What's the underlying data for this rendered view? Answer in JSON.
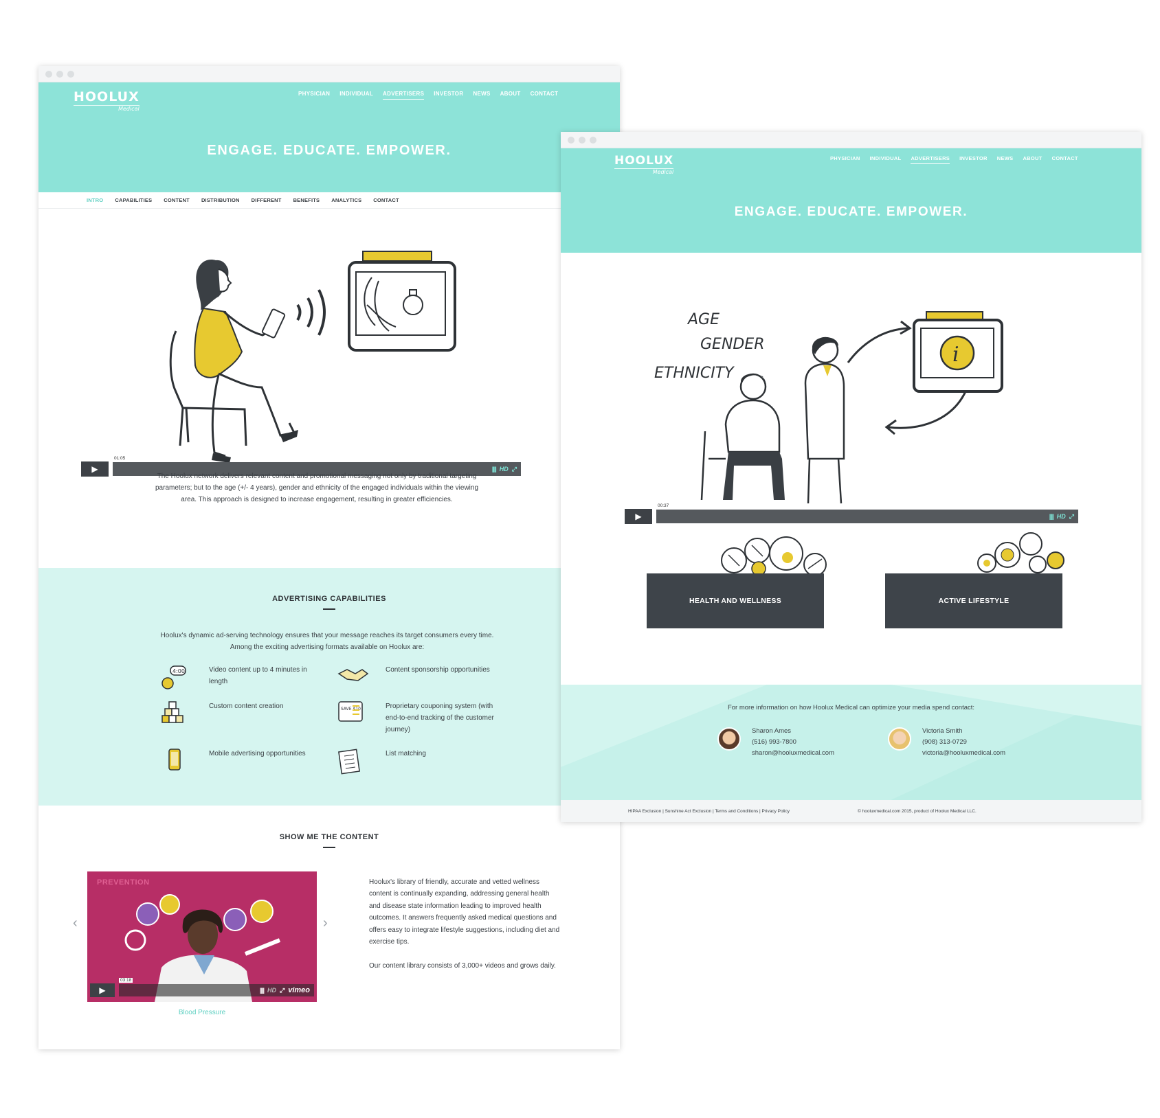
{
  "window_a": {
    "logo": "HOOLUX",
    "logo_sub": "Medical",
    "nav": [
      "PHYSICIAN",
      "INDIVIDUAL",
      "ADVERTISERS",
      "INVESTOR",
      "NEWS",
      "ABOUT",
      "CONTACT"
    ],
    "hero_title": "ENGAGE. EDUCATE. EMPOWER.",
    "subnav": [
      "INTRO",
      "CAPABILITIES",
      "CONTENT",
      "DISTRIBUTION",
      "DIFFERENT",
      "BENEFITS",
      "ANALYTICS",
      "CONTACT"
    ],
    "video_time": "01:05",
    "hd_label": "HD",
    "intro_text": "The Hoolux network delivers relevant content and promotional messaging not only by traditional targeting parameters; but to the age (+/- 4 years), gender and ethnicity of the engaged individuals within the viewing area. This approach is designed to increase engagement, resulting in greater efficiencies.",
    "cap_title": "ADVERTISING CAPABILITIES",
    "cap_intro": "Hoolux's dynamic ad-serving technology ensures that your message reaches its target consumers every time. Among the exciting advertising formats available on Hoolux are:",
    "features": {
      "f1": "Video content up to 4 minutes in length",
      "f2": "Content sponsorship opportunities",
      "f3": "Custom content creation",
      "f4": "Proprietary couponing system (with end-to-end tracking of the customer journey)",
      "f5": "Mobile advertising opportunities",
      "f6": "List matching",
      "clock": "4:00",
      "coupon": "SAVE $10"
    },
    "content_title": "SHOW ME THE CONTENT",
    "video_label": "PREVENTION",
    "video2_time": "03:18",
    "vimeo": "vimeo",
    "content_p1": "Hoolux's library of friendly, accurate and vetted wellness content is continually expanding, addressing general health and disease state information leading to improved health outcomes. It answers frequently asked medical questions and offers easy to integrate lifestyle suggestions, including diet and exercise tips.",
    "content_p2": "Our content library consists of 3,000+ videos and grows daily.",
    "caption": "Blood Pressure",
    "arrow_left": "‹",
    "arrow_right": "›"
  },
  "window_b": {
    "logo": "HOOLUX",
    "logo_sub": "Medical",
    "nav": [
      "PHYSICIAN",
      "INDIVIDUAL",
      "ADVERTISERS",
      "INVESTOR",
      "NEWS",
      "ABOUT",
      "CONTACT"
    ],
    "hero_title": "ENGAGE. EDUCATE. EMPOWER.",
    "sketch_words": [
      "AGE",
      "GENDER",
      "ETHNICITY"
    ],
    "video_time": "00:37",
    "hd_label": "HD",
    "card1": "HEALTH AND WELLNESS",
    "card2": "ACTIVE LIFESTYLE",
    "contact_lead": "For more information on how Hoolux Medical can optimize your media spend contact:",
    "contacts": [
      {
        "name": "Sharon Ames",
        "phone": "(516) 993-7800",
        "email": "sharon@hooluxmedical.com"
      },
      {
        "name": "Victoria Smith",
        "phone": "(908) 313-0729",
        "email": "victoria@hooluxmedical.com"
      }
    ],
    "footer_links": "HIPAA Exclusion | Sunshine Act Exclusion | Terms and Conditions | Privacy Policy",
    "footer_copy": "© hooluxmedical.com 2015, product of Hoolux Medical LLC."
  },
  "colors": {
    "accent": "#8de3d8",
    "light_band": "#d6f5f0",
    "dark": "#3e444a",
    "link": "#5ccfc1",
    "yellow": "#e8c730"
  }
}
